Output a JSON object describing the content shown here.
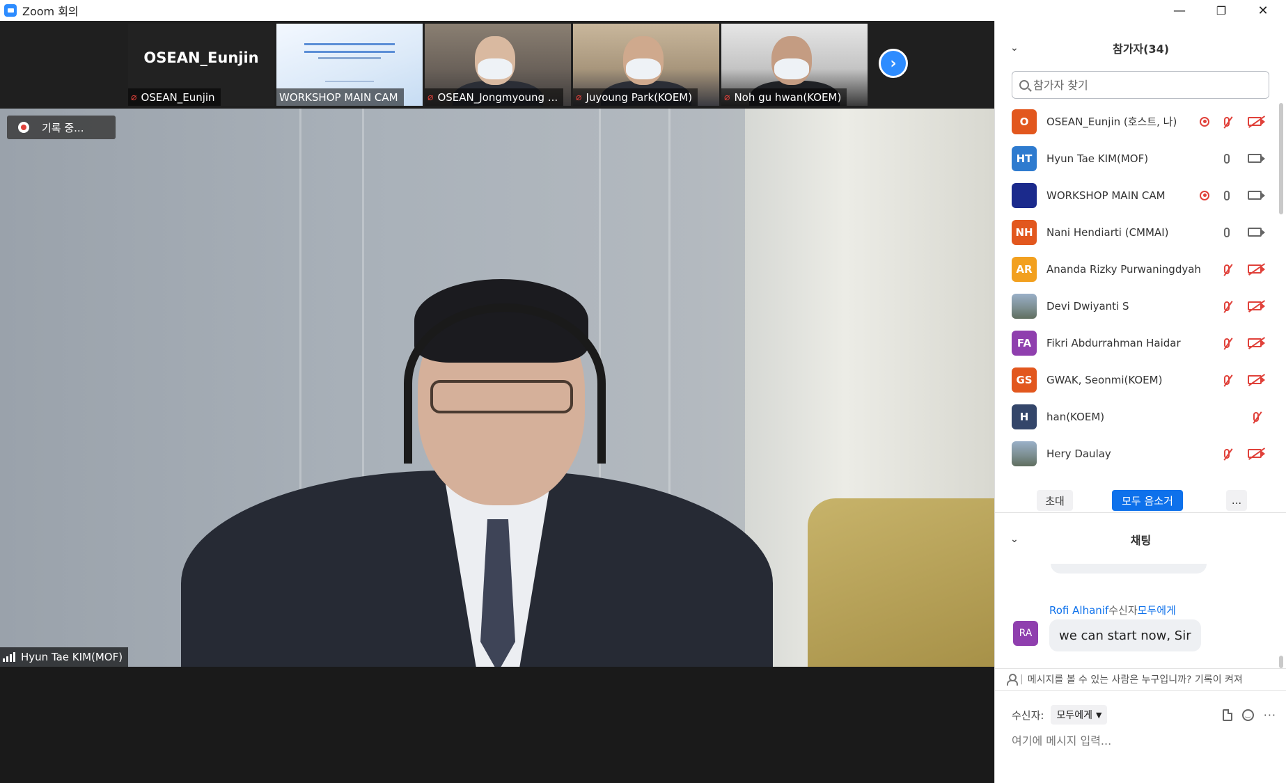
{
  "window": {
    "title": "Zoom 회의",
    "minimize": "—",
    "restore": "❐",
    "close": "✕"
  },
  "video_strip": {
    "thumbnails": [
      {
        "name": "OSEAN_Eunjin",
        "display_name": "OSEAN_Eunjin",
        "mic_muted": true,
        "kind": "name-only"
      },
      {
        "name": "WORKSHOP MAIN CAM",
        "mic_muted": false,
        "kind": "slide"
      },
      {
        "name": "OSEAN_Jongmyoung ...",
        "mic_muted": true,
        "kind": "person"
      },
      {
        "name": "Juyoung Park(KOEM)",
        "mic_muted": true,
        "kind": "person"
      },
      {
        "name": "Noh gu hwan(KOEM)",
        "mic_muted": true,
        "kind": "person"
      }
    ],
    "next_icon": "›"
  },
  "main_video": {
    "recording_label": "기록 중...",
    "speaker_name": "Hyun Tae KIM(MOF)"
  },
  "participants": {
    "header": "참가자(34)",
    "search_placeholder": "참가자 찾기",
    "list": [
      {
        "initials": "O",
        "color": "#e2571e",
        "name": "OSEAN_Eunjin (호스트, 나)",
        "recording": true,
        "mic": "off",
        "cam": "off"
      },
      {
        "initials": "HT",
        "color": "#2e7bcf",
        "name": "Hyun Tae KIM(MOF)",
        "recording": false,
        "mic": "on",
        "cam": "on"
      },
      {
        "initials": "",
        "color": "#1b2a8c",
        "name": "WORKSHOP MAIN CAM",
        "recording": true,
        "mic": "on",
        "cam": "on"
      },
      {
        "initials": "NH",
        "color": "#e2571e",
        "name": "Nani Hendiarti (CMMAI)",
        "recording": false,
        "mic": "on",
        "cam": "on"
      },
      {
        "initials": "AR",
        "color": "#f2a01f",
        "name": "Ananda Rizky Purwaningdyah",
        "recording": false,
        "mic": "off",
        "cam": "off"
      },
      {
        "initials": "",
        "color": "photo",
        "name": "Devi Dwiyanti S",
        "recording": false,
        "mic": "off",
        "cam": "off"
      },
      {
        "initials": "FA",
        "color": "#8f3fae",
        "name": "Fikri Abdurrahman Haidar",
        "recording": false,
        "mic": "off",
        "cam": "off"
      },
      {
        "initials": "GS",
        "color": "#e2571e",
        "name": "GWAK, Seonmi(KOEM)",
        "recording": false,
        "mic": "off",
        "cam": "off"
      },
      {
        "initials": "H",
        "color": "#34466a",
        "name": "han(KOEM)",
        "recording": false,
        "mic": "off",
        "cam": "none"
      },
      {
        "initials": "",
        "color": "photo",
        "name": "Hery Daulay",
        "recording": false,
        "mic": "off",
        "cam": "off"
      }
    ],
    "invite_label": "초대",
    "mute_all_label": "모두 음소거",
    "more_label": "..."
  },
  "chat": {
    "header": "채팅",
    "messages": [
      {
        "sender": "Rofi Alhanif",
        "to_label": "수신자",
        "to": "모두에게",
        "avatar_initials": "RA",
        "text": "we can start now, Sir"
      }
    ],
    "privacy_notice": "메시지를 볼 수 있는 사람은 누구입니까? 기록이 켜져",
    "to_row_label": "수신자:",
    "to_selected": "모두에게",
    "input_placeholder": "여기에 메시지 입력..."
  },
  "colors": {
    "accent": "#0e71eb",
    "muted_red": "#e0413a",
    "zoom_blue": "#2d8cff"
  }
}
